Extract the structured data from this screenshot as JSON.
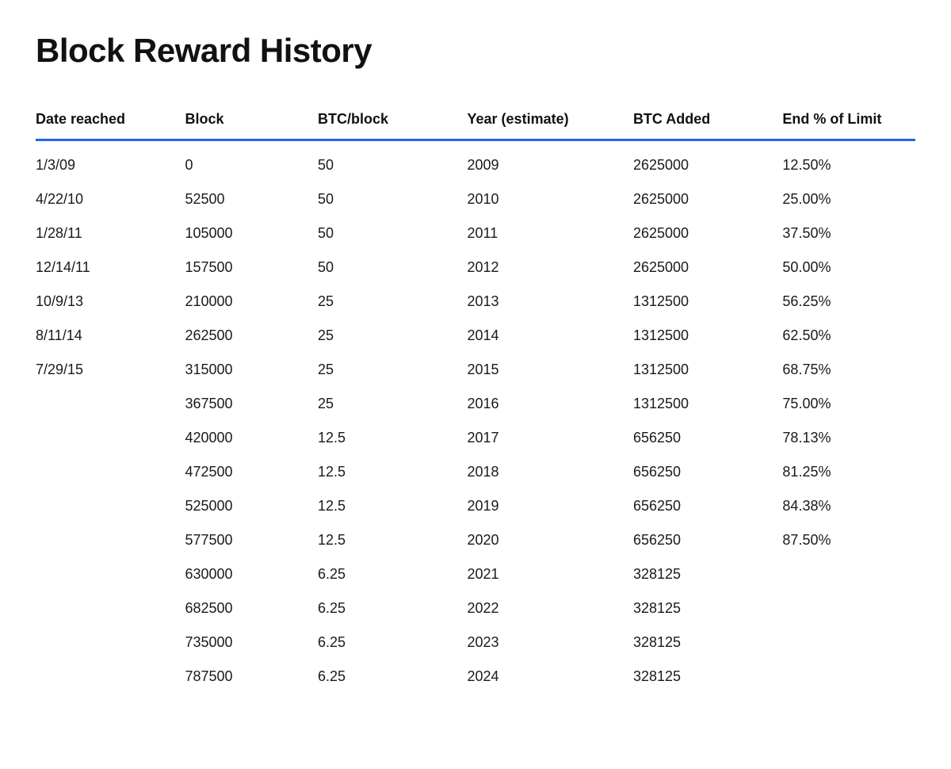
{
  "page": {
    "title": "Block Reward History"
  },
  "table": {
    "headers": [
      "Date reached",
      "Block",
      "BTC/block",
      "Year (estimate)",
      "BTC Added",
      "End % of Limit"
    ],
    "rows": [
      {
        "date": "1/3/09",
        "block": "0",
        "btc_block": "50",
        "year": "2009",
        "btc_added": "2625000",
        "end_pct": "12.50%"
      },
      {
        "date": "4/22/10",
        "block": "52500",
        "btc_block": "50",
        "year": "2010",
        "btc_added": "2625000",
        "end_pct": "25.00%"
      },
      {
        "date": "1/28/11",
        "block": "105000",
        "btc_block": "50",
        "year": "2011",
        "btc_added": "2625000",
        "end_pct": "37.50%"
      },
      {
        "date": "12/14/11",
        "block": "157500",
        "btc_block": "50",
        "year": "2012",
        "btc_added": "2625000",
        "end_pct": "50.00%"
      },
      {
        "date": "10/9/13",
        "block": "210000",
        "btc_block": "25",
        "year": "2013",
        "btc_added": "1312500",
        "end_pct": "56.25%"
      },
      {
        "date": "8/11/14",
        "block": "262500",
        "btc_block": "25",
        "year": "2014",
        "btc_added": "1312500",
        "end_pct": "62.50%"
      },
      {
        "date": "7/29/15",
        "block": "315000",
        "btc_block": "25",
        "year": "2015",
        "btc_added": "1312500",
        "end_pct": "68.75%"
      },
      {
        "date": "",
        "block": "367500",
        "btc_block": "25",
        "year": "2016",
        "btc_added": "1312500",
        "end_pct": "75.00%"
      },
      {
        "date": "",
        "block": "420000",
        "btc_block": "12.5",
        "year": "2017",
        "btc_added": "656250",
        "end_pct": "78.13%"
      },
      {
        "date": "",
        "block": "472500",
        "btc_block": "12.5",
        "year": "2018",
        "btc_added": "656250",
        "end_pct": "81.25%"
      },
      {
        "date": "",
        "block": "525000",
        "btc_block": "12.5",
        "year": "2019",
        "btc_added": "656250",
        "end_pct": "84.38%"
      },
      {
        "date": "",
        "block": "577500",
        "btc_block": "12.5",
        "year": "2020",
        "btc_added": "656250",
        "end_pct": "87.50%"
      },
      {
        "date": "",
        "block": "630000",
        "btc_block": "6.25",
        "year": "2021",
        "btc_added": "328125",
        "end_pct": ""
      },
      {
        "date": "",
        "block": "682500",
        "btc_block": "6.25",
        "year": "2022",
        "btc_added": "328125",
        "end_pct": ""
      },
      {
        "date": "",
        "block": "735000",
        "btc_block": "6.25",
        "year": "2023",
        "btc_added": "328125",
        "end_pct": ""
      },
      {
        "date": "",
        "block": "787500",
        "btc_block": "6.25",
        "year": "2024",
        "btc_added": "328125",
        "end_pct": ""
      }
    ]
  }
}
